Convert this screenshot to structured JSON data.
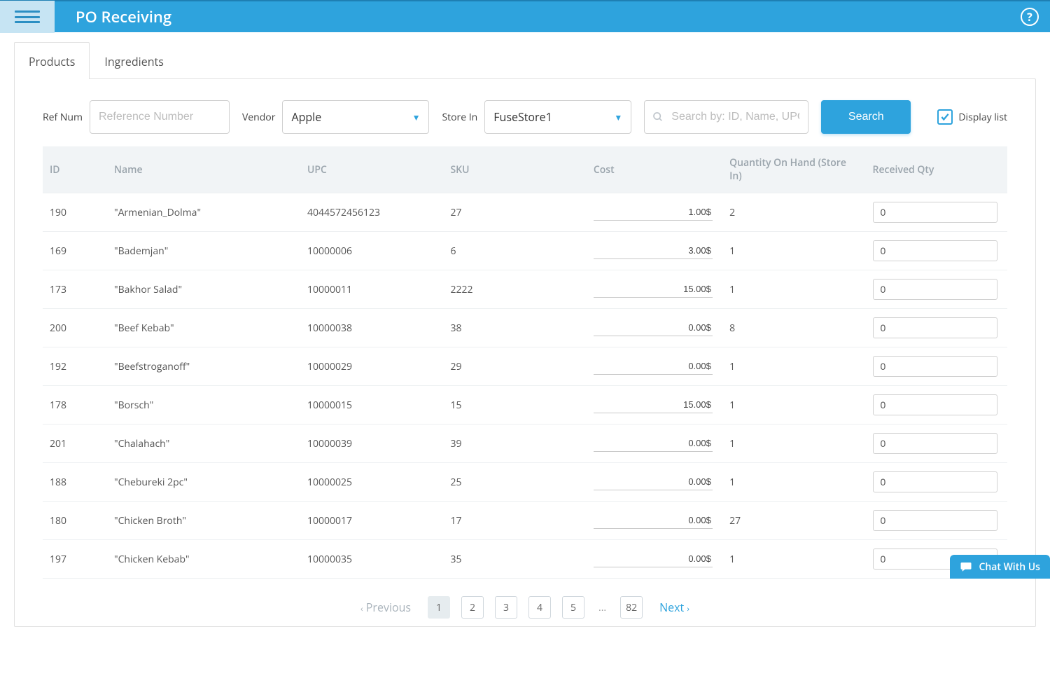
{
  "header": {
    "title": "PO Receiving"
  },
  "tabs": {
    "products": "Products",
    "ingredients": "Ingredients"
  },
  "filters": {
    "refnum_label": "Ref Num",
    "refnum_placeholder": "Reference Number",
    "vendor_label": "Vendor",
    "vendor_value": "Apple",
    "store_label": "Store In",
    "store_value": "FuseStore1",
    "search_placeholder": "Search by: ID, Name, UPC, S",
    "search_button": "Search",
    "display_list_label": "Display list",
    "display_list_checked": true
  },
  "table": {
    "headers": {
      "id": "ID",
      "name": "Name",
      "upc": "UPC",
      "sku": "SKU",
      "cost": "Cost",
      "qoh": "Quantity On Hand (Store In)",
      "rqty": "Received Qty"
    },
    "rows": [
      {
        "id": "190",
        "name": "\"Armenian_Dolma\"",
        "upc": "4044572456123",
        "sku": "27",
        "cost": "1.00$",
        "qoh": "2",
        "rqty": "0"
      },
      {
        "id": "169",
        "name": "\"Bademjan\"",
        "upc": "10000006",
        "sku": "6",
        "cost": "3.00$",
        "qoh": "1",
        "rqty": "0"
      },
      {
        "id": "173",
        "name": "\"Bakhor Salad\"",
        "upc": "10000011",
        "sku": "2222",
        "cost": "15.00$",
        "qoh": "1",
        "rqty": "0"
      },
      {
        "id": "200",
        "name": "\"Beef Kebab\"",
        "upc": "10000038",
        "sku": "38",
        "cost": "0.00$",
        "qoh": "8",
        "rqty": "0"
      },
      {
        "id": "192",
        "name": "\"Beefstroganoff\"",
        "upc": "10000029",
        "sku": "29",
        "cost": "0.00$",
        "qoh": "1",
        "rqty": "0"
      },
      {
        "id": "178",
        "name": "\"Borsch\"",
        "upc": "10000015",
        "sku": "15",
        "cost": "15.00$",
        "qoh": "1",
        "rqty": "0"
      },
      {
        "id": "201",
        "name": "\"Chalahach\"",
        "upc": "10000039",
        "sku": "39",
        "cost": "0.00$",
        "qoh": "1",
        "rqty": "0"
      },
      {
        "id": "188",
        "name": "\"Chebureki 2pc\"",
        "upc": "10000025",
        "sku": "25",
        "cost": "0.00$",
        "qoh": "1",
        "rqty": "0"
      },
      {
        "id": "180",
        "name": "\"Chicken Broth\"",
        "upc": "10000017",
        "sku": "17",
        "cost": "0.00$",
        "qoh": "27",
        "rqty": "0"
      },
      {
        "id": "197",
        "name": "\"Chicken Kebab\"",
        "upc": "10000035",
        "sku": "35",
        "cost": "0.00$",
        "qoh": "1",
        "rqty": "0"
      }
    ]
  },
  "pagination": {
    "previous": "Previous",
    "next": "Next",
    "pages": [
      "1",
      "2",
      "3",
      "4",
      "5"
    ],
    "ellipsis": "...",
    "last": "82",
    "active": "1"
  },
  "chat": {
    "label": "Chat With Us"
  }
}
